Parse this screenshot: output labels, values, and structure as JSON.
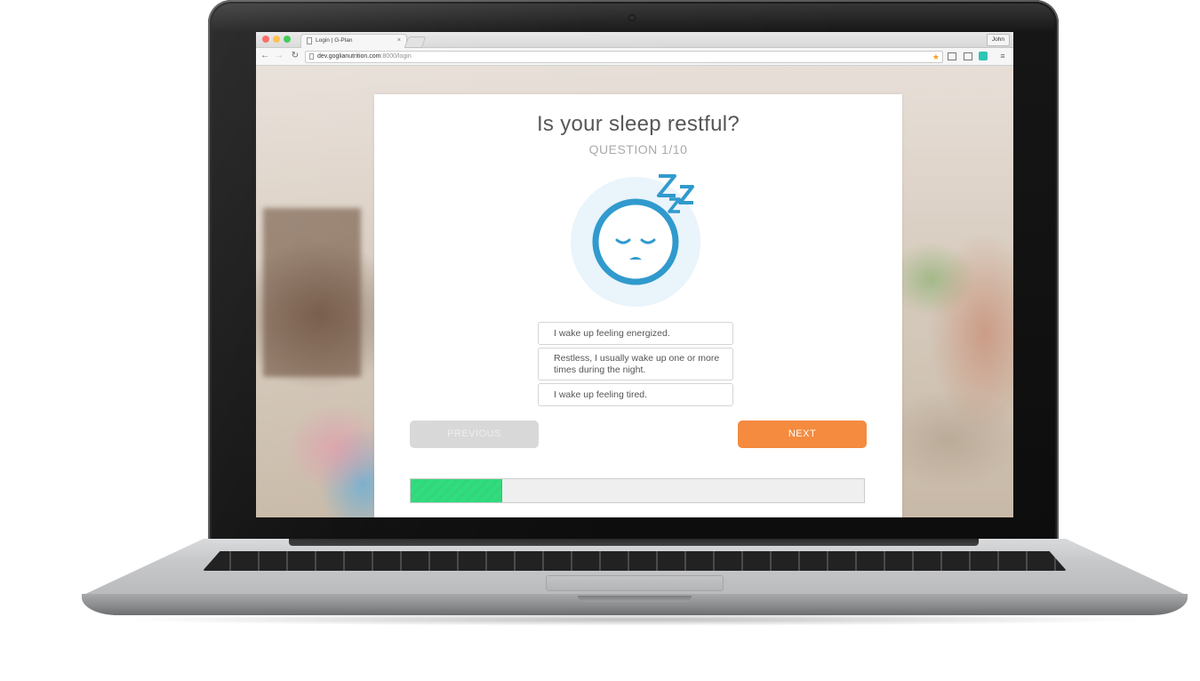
{
  "browser": {
    "tab_title": "Login | G-Plan",
    "tab_close": "×",
    "profile_name": "John",
    "url_host": "dev.goglianutrition.com",
    "url_path": ":8000/login",
    "nav": {
      "back": "←",
      "forward": "→",
      "reload": "↻"
    },
    "menu_icon": "≡",
    "bookmark_icon": "★"
  },
  "quiz": {
    "question": "Is your sleep restful?",
    "progress_label": "QUESTION 1/10",
    "illustration": "sleeping-face-icon",
    "options": [
      {
        "text": "I wake up feeling energized."
      },
      {
        "text": "Restless, I usually wake up one or more times during the night."
      },
      {
        "text": "I wake up feeling tired."
      }
    ],
    "previous_label": "PREVIOUS",
    "next_label": "NEXT",
    "progress": {
      "current": 1,
      "total": 10,
      "fraction": 0.2
    }
  },
  "colors": {
    "accent_next": "#f98a3a",
    "previous_disabled": "#d8d8d8",
    "progress_fill": "#25e07a",
    "illustration_blue": "#2a9ad1",
    "illustration_bg": "#e9f4fb"
  }
}
